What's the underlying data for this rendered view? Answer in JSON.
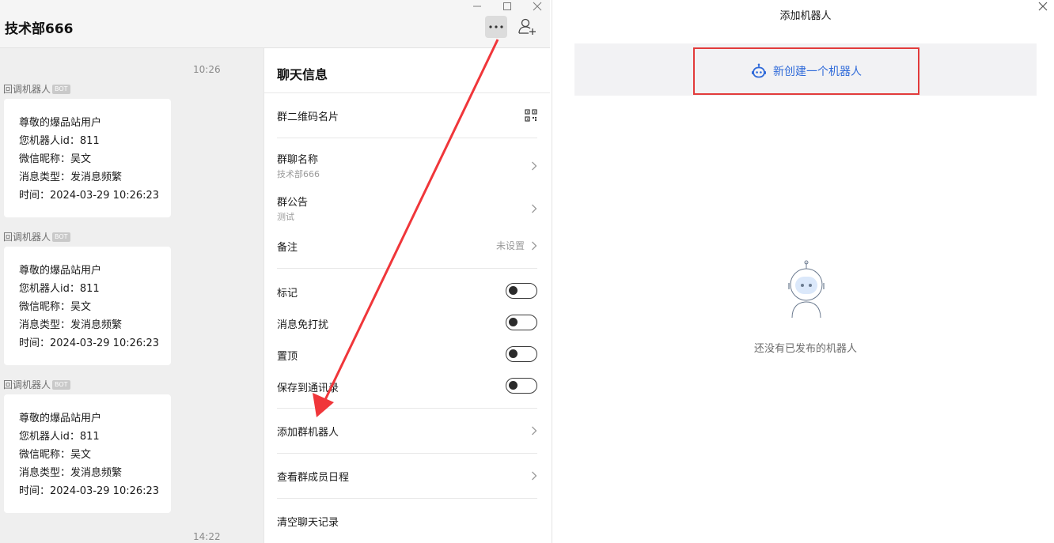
{
  "chat": {
    "group_name": "技术部666",
    "time_top": "10:26",
    "time_bottom": "14:22",
    "messages": [
      {
        "sender": "回调机器人",
        "badge": "BOT",
        "lines": [
          "尊敬的爆品站用户",
          "您机器人id：811",
          "微信昵称：吴文",
          "消息类型：发消息频繁",
          "时间：2024-03-29 10:26:23"
        ]
      },
      {
        "sender": "回调机器人",
        "badge": "BOT",
        "lines": [
          "尊敬的爆品站用户",
          "您机器人id：811",
          "微信昵称：吴文",
          "消息类型：发消息频繁",
          "时间：2024-03-29 10:26:23"
        ]
      },
      {
        "sender": "回调机器人",
        "badge": "BOT",
        "lines": [
          "尊敬的爆品站用户",
          "您机器人id：811",
          "微信昵称：吴文",
          "消息类型：发消息频繁",
          "时间：2024-03-29 10:26:23"
        ]
      }
    ]
  },
  "info_panel": {
    "title": "聊天信息",
    "qr_card": "群二维码名片",
    "group_name_label": "群聊名称",
    "group_name_value": "技术部666",
    "announcement_label": "群公告",
    "announcement_value": "测试",
    "remark_label": "备注",
    "remark_value": "未设置",
    "mark_label": "标记",
    "mute_label": "消息免打扰",
    "pin_label": "置顶",
    "save_contacts_label": "保存到通讯录",
    "add_bot_label": "添加群机器人",
    "schedule_label": "查看群成员日程",
    "clear_history_label": "清空聊天记录",
    "toggles": {
      "mark": false,
      "mute": false,
      "pin": false,
      "save_contacts": false
    }
  },
  "dialog": {
    "title": "添加机器人",
    "create_label": "新创建一个机器人",
    "empty_text": "还没有已发布的机器人"
  },
  "colors": {
    "accent_blue": "#2f6ad9",
    "highlight_red": "#e23b3b",
    "arrow_red": "#f0363a"
  }
}
